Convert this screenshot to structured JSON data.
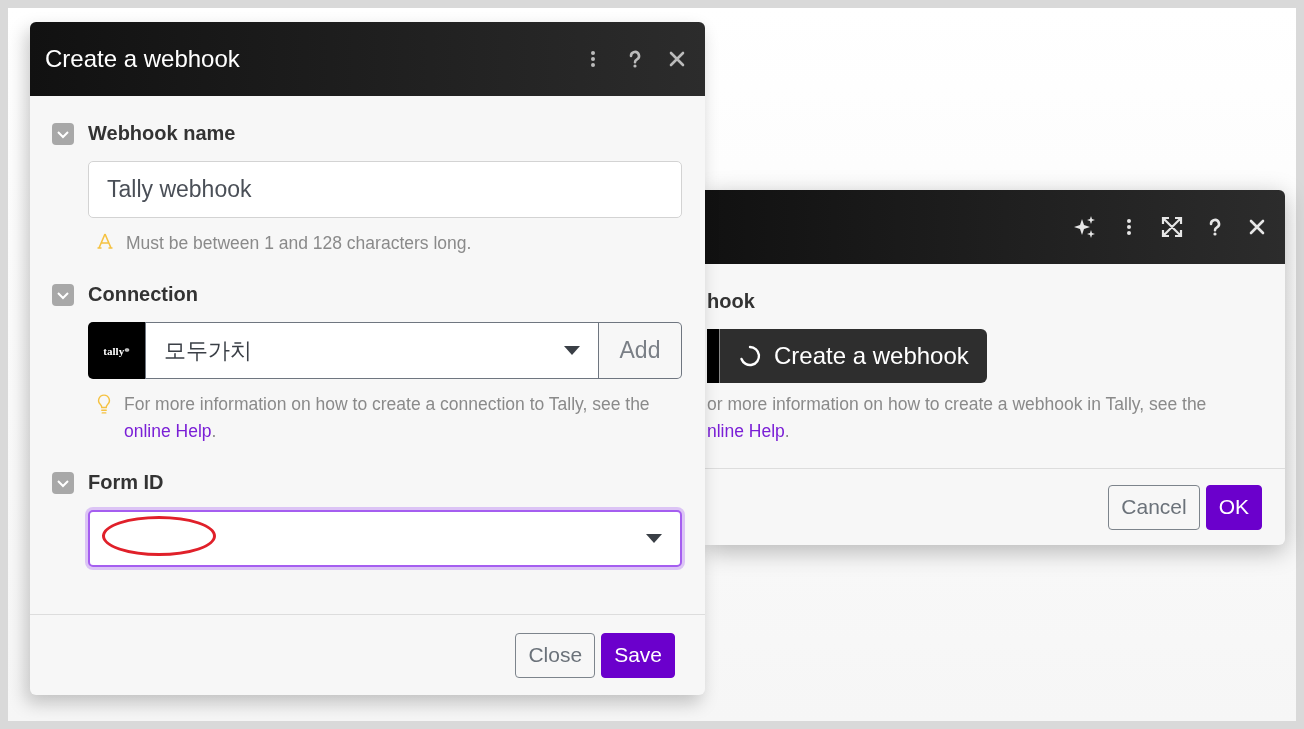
{
  "main_dialog": {
    "title": "Create a webhook",
    "fields": [
      {
        "kind": "text",
        "label": "Webhook name",
        "value": "Tally webhook",
        "hint": {
          "kind": "warning",
          "before": "Must be between 1 and 128 characters long."
        }
      },
      {
        "kind": "connection",
        "label": "Connection",
        "logo": "tally*",
        "value": "모두가치",
        "add_button": "Add",
        "hint": {
          "kind": "tip",
          "before": "For more information on how to create a connection to Tally, see the",
          "link": "online Help",
          "after": "."
        }
      },
      {
        "kind": "select",
        "label": "Form ID",
        "focused": true,
        "annotated": true
      }
    ],
    "buttons": [
      {
        "label": "Close",
        "kind": "secondary"
      },
      {
        "label": "Save",
        "kind": "primary"
      }
    ]
  },
  "background_dialog": {
    "field_label": "hook",
    "action_button": "Create a webhook",
    "loading": true,
    "hint": {
      "before": "or more information on how to create a webhook in Tally, see the",
      "link": "nline Help",
      "after": "."
    },
    "buttons": [
      {
        "label": "Cancel",
        "kind": "secondary"
      },
      {
        "label": "OK",
        "kind": "primary"
      }
    ]
  }
}
